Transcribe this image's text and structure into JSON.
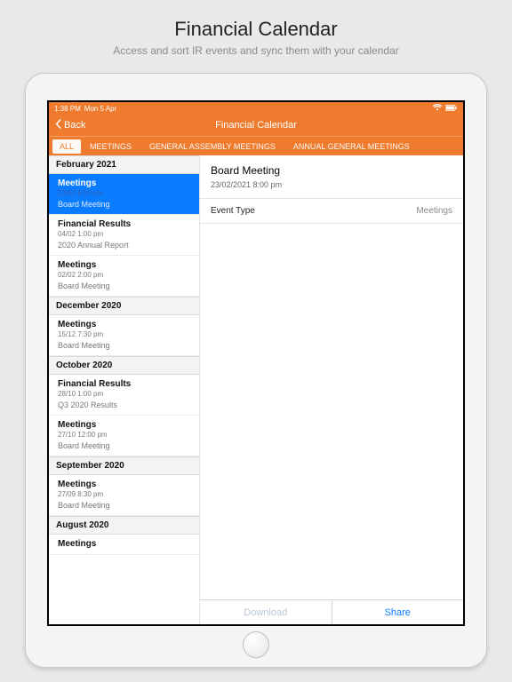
{
  "promo": {
    "title": "Financial Calendar",
    "subtitle": "Access and sort IR events and sync them with your calendar"
  },
  "status": {
    "time": "1:38 PM",
    "date": "Mon 5 Apr"
  },
  "nav": {
    "back": "Back",
    "title": "Financial Calendar"
  },
  "tabs": {
    "items": [
      "ALL",
      "MEETINGS",
      "GENERAL ASSEMBLY MEETINGS",
      "ANNUAL GENERAL MEETINGS"
    ],
    "active_index": 0
  },
  "list": [
    {
      "type": "section",
      "label": "February 2021"
    },
    {
      "type": "event",
      "selected": true,
      "title": "Meetings",
      "dt": "23/02 8:00 pm",
      "desc": "Board Meeting"
    },
    {
      "type": "event",
      "selected": false,
      "title": "Financial Results",
      "dt": "04/02 1:00 pm",
      "desc": "2020 Annual Report"
    },
    {
      "type": "event",
      "selected": false,
      "title": "Meetings",
      "dt": "02/02 2:00 pm",
      "desc": "Board Meeting"
    },
    {
      "type": "section",
      "label": "December 2020"
    },
    {
      "type": "event",
      "selected": false,
      "title": "Meetings",
      "dt": "15/12 7:30 pm",
      "desc": "Board Meeting"
    },
    {
      "type": "section",
      "label": "October 2020"
    },
    {
      "type": "event",
      "selected": false,
      "title": "Financial Results",
      "dt": "28/10 1:00 pm",
      "desc": "Q3 2020 Results"
    },
    {
      "type": "event",
      "selected": false,
      "title": "Meetings",
      "dt": "27/10 12:00 pm",
      "desc": "Board Meeting"
    },
    {
      "type": "section",
      "label": "September 2020"
    },
    {
      "type": "event",
      "selected": false,
      "title": "Meetings",
      "dt": "27/09 8:30 pm",
      "desc": "Board Meeting"
    },
    {
      "type": "section",
      "label": "August 2020"
    },
    {
      "type": "event",
      "selected": false,
      "title": "Meetings",
      "dt": "",
      "desc": ""
    }
  ],
  "detail": {
    "title": "Board Meeting",
    "datetime": "23/02/2021 8:00 pm",
    "rows": [
      {
        "label": "Event Type",
        "value": "Meetings"
      }
    ]
  },
  "actions": {
    "download": "Download",
    "share": "Share"
  }
}
